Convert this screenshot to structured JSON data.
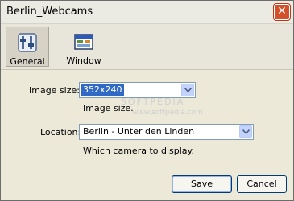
{
  "window": {
    "title": "Berlin_Webcams"
  },
  "toolbar": {
    "items": [
      {
        "label": "General",
        "icon": "settings-general-icon"
      },
      {
        "label": "Window",
        "icon": "window-icon"
      }
    ]
  },
  "image_size": {
    "label": "Image size:",
    "value": "352x240",
    "hint": "Image size."
  },
  "location": {
    "label": "Location:",
    "value": "Berlin - Unter den Linden",
    "hint": "Which camera to display."
  },
  "buttons": {
    "save": "Save",
    "cancel": "Cancel"
  },
  "watermark": {
    "brand": "SOFTPEDIA",
    "url": "www.softpedia.com"
  }
}
